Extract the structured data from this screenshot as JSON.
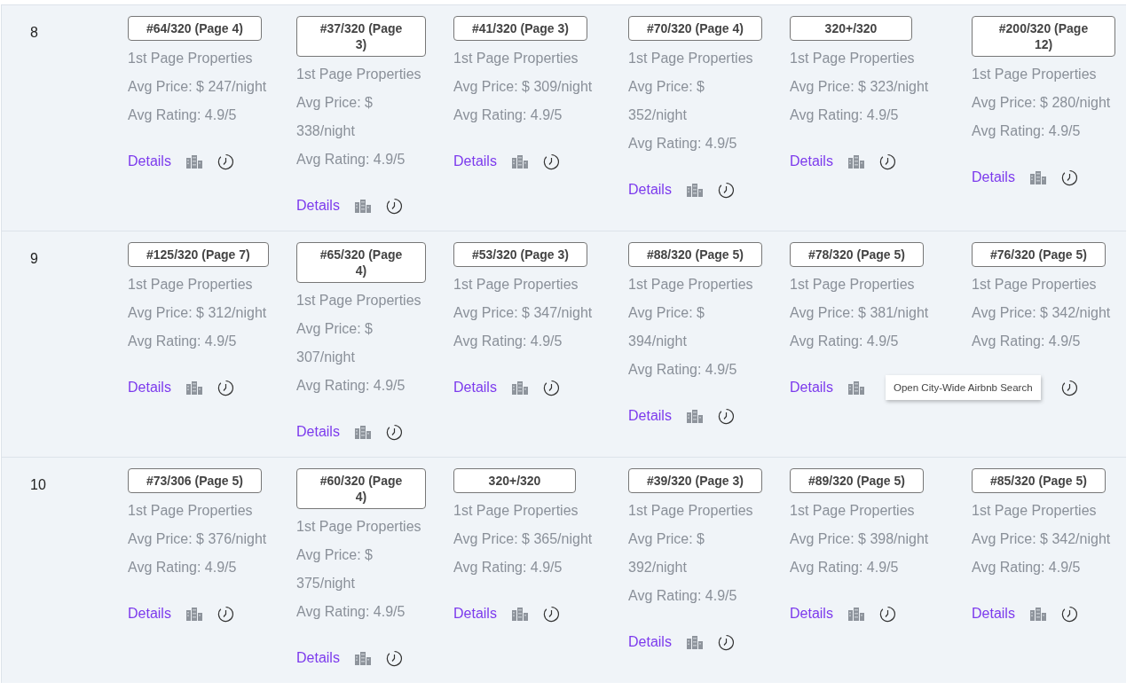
{
  "rows": [
    {
      "number": "8",
      "cells": [
        {
          "rank": "#64/320 (Page 4)",
          "label": "1st Page Properties",
          "price": "Avg Price: $ 247/night",
          "rating": "Avg Rating: 4.9/5",
          "details": "Details",
          "building_icon": true,
          "clock_icon": true
        },
        {
          "rank": "#37/320 (Page 3)",
          "label": "1st Page Properties",
          "price": "Avg Price: $ 338/night",
          "rating": "Avg Rating: 4.9/5",
          "details": "Details",
          "building_icon": true,
          "clock_icon": true
        },
        {
          "rank": "#41/320 (Page 3)",
          "label": "1st Page Properties",
          "price": "Avg Price: $ 309/night",
          "rating": "Avg Rating: 4.9/5",
          "details": "Details",
          "building_icon": true,
          "clock_icon": true
        },
        {
          "rank": "#70/320 (Page 4)",
          "label": "1st Page Properties",
          "price": "Avg Price: $ 352/night",
          "rating": "Avg Rating: 4.9/5",
          "details": "Details",
          "building_icon": true,
          "clock_icon": true
        },
        {
          "rank": "320+/320",
          "label": "1st Page Properties",
          "price": "Avg Price: $ 323/night",
          "rating": "Avg Rating: 4.9/5",
          "details": "Details",
          "building_icon": true,
          "clock_icon": true
        },
        {
          "rank": "#200/320 (Page 12)",
          "label": "1st Page Properties",
          "price": "Avg Price: $ 280/night",
          "rating": "Avg Rating: 4.9/5",
          "details": "Details",
          "building_icon": true,
          "clock_icon": true
        }
      ]
    },
    {
      "number": "9",
      "cells": [
        {
          "rank": "#125/320 (Page 7)",
          "label": "1st Page Properties",
          "price": "Avg Price: $ 312/night",
          "rating": "Avg Rating: 4.9/5",
          "details": "Details",
          "building_icon": true,
          "clock_icon": true
        },
        {
          "rank": "#65/320 (Page 4)",
          "label": "1st Page Properties",
          "price": "Avg Price: $ 307/night",
          "rating": "Avg Rating: 4.9/5",
          "details": "Details",
          "building_icon": true,
          "clock_icon": true
        },
        {
          "rank": "#53/320 (Page 3)",
          "label": "1st Page Properties",
          "price": "Avg Price: $ 347/night",
          "rating": "Avg Rating: 4.9/5",
          "details": "Details",
          "building_icon": true,
          "clock_icon": true
        },
        {
          "rank": "#88/320 (Page 5)",
          "label": "1st Page Properties",
          "price": "Avg Price: $ 394/night",
          "rating": "Avg Rating: 4.9/5",
          "details": "Details",
          "building_icon": true,
          "clock_icon": true
        },
        {
          "rank": "#78/320 (Page 5)",
          "label": "1st Page Properties",
          "price": "Avg Price: $ 381/night",
          "rating": "Avg Rating: 4.9/5",
          "details": "Details",
          "building_icon": true,
          "clock_icon": false,
          "tooltip": "Open City-Wide Airbnb Search"
        },
        {
          "rank": "#76/320 (Page 5)",
          "label": "1st Page Properties",
          "price": "Avg Price: $ 342/night",
          "rating": "Avg Rating: 4.9/5",
          "building_icon": false,
          "clock_icon": true
        }
      ]
    },
    {
      "number": "10",
      "cells": [
        {
          "rank": "#73/306 (Page 5)",
          "label": "1st Page Properties",
          "price": "Avg Price: $ 376/night",
          "rating": "Avg Rating: 4.9/5",
          "details": "Details",
          "building_icon": true,
          "clock_icon": true
        },
        {
          "rank": "#60/320 (Page 4)",
          "label": "1st Page Properties",
          "price": "Avg Price: $ 375/night",
          "rating": "Avg Rating: 4.9/5",
          "details": "Details",
          "building_icon": true,
          "clock_icon": true
        },
        {
          "rank": "320+/320",
          "label": "1st Page Properties",
          "price": "Avg Price: $ 365/night",
          "rating": "Avg Rating: 4.9/5",
          "details": "Details",
          "building_icon": true,
          "clock_icon": true
        },
        {
          "rank": "#39/320 (Page 3)",
          "label": "1st Page Properties",
          "price": "Avg Price: $ 392/night",
          "rating": "Avg Rating: 4.9/5",
          "details": "Details",
          "building_icon": true,
          "clock_icon": true
        },
        {
          "rank": "#89/320 (Page 5)",
          "label": "1st Page Properties",
          "price": "Avg Price: $ 398/night",
          "rating": "Avg Rating: 4.9/5",
          "details": "Details",
          "building_icon": true,
          "clock_icon": true
        },
        {
          "rank": "#85/320 (Page 5)",
          "label": "1st Page Properties",
          "price": "Avg Price: $ 342/night",
          "rating": "Avg Rating: 4.9/5",
          "details": "Details",
          "building_icon": true,
          "clock_icon": true
        }
      ]
    }
  ]
}
